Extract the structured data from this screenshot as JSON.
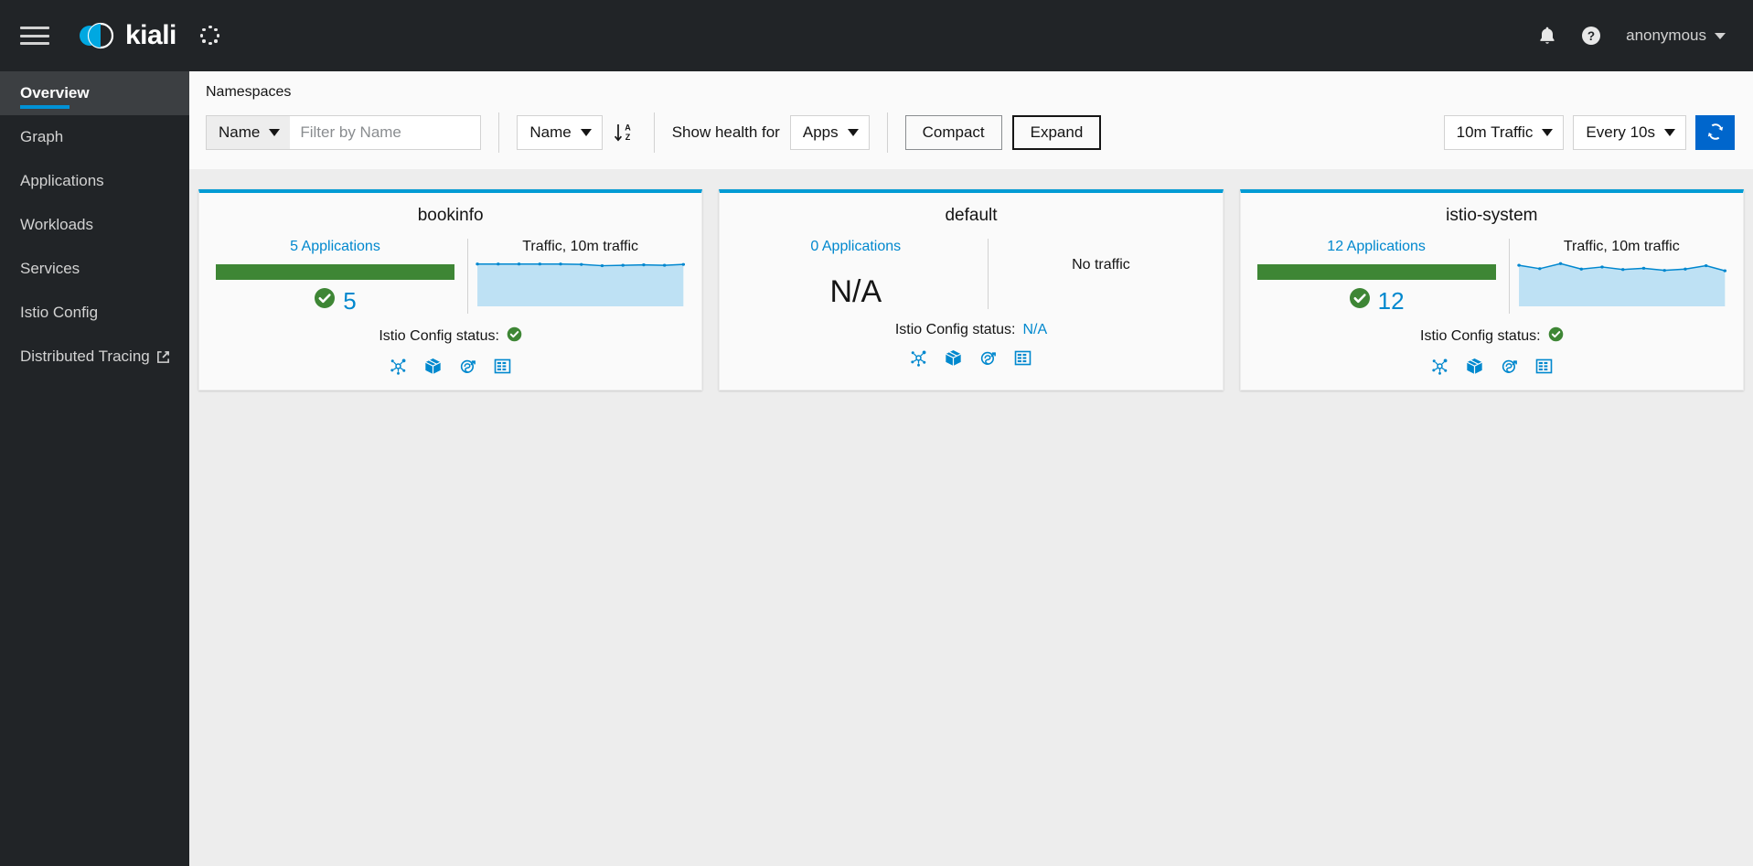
{
  "masthead": {
    "menu_icon": "hamburger-icon",
    "brand_name": "kiali",
    "loading_icon": "loading-spinner-icon",
    "notifications_icon": "bell-icon",
    "help_icon": "help-circle-icon",
    "user_name": "anonymous",
    "user_caret_icon": "chevron-down-icon"
  },
  "sidebar": {
    "items": [
      {
        "label": "Overview",
        "active": true,
        "external": false
      },
      {
        "label": "Graph",
        "active": false,
        "external": false
      },
      {
        "label": "Applications",
        "active": false,
        "external": false
      },
      {
        "label": "Workloads",
        "active": false,
        "external": false
      },
      {
        "label": "Services",
        "active": false,
        "external": false
      },
      {
        "label": "Istio Config",
        "active": false,
        "external": false
      },
      {
        "label": "Distributed Tracing",
        "active": false,
        "external": true
      }
    ]
  },
  "toolbar": {
    "title": "Namespaces",
    "filter_category": "Name",
    "filter_placeholder": "Filter by Name",
    "filter_value": "",
    "sort_field": "Name",
    "sort_direction_icon": "sort-ascending-az-icon",
    "show_health_label": "Show health for",
    "health_scope": "Apps",
    "compact_label": "Compact",
    "expand_label": "Expand",
    "active_view": "Expand",
    "traffic_range": "10m Traffic",
    "refresh_interval": "Every 10s",
    "refresh_icon": "refresh-icon",
    "refresh_button_color": "#0066cc"
  },
  "colors": {
    "card_accent": "#009bd4",
    "health_green": "#3e8635",
    "link_blue": "#0088ce",
    "chart_line": "#0087cf",
    "chart_fill": "#bee1f4",
    "sidebar_bg": "#212427"
  },
  "cards": [
    {
      "name": "bookinfo",
      "apps_link": "5 Applications",
      "has_health_bar": true,
      "health_count": "5",
      "health_status_icon": "check-circle-icon",
      "health_value_na": "",
      "traffic_title": "Traffic, 10m traffic",
      "has_traffic": true,
      "no_traffic_label": "",
      "istio_status_label": "Istio Config status:",
      "istio_status_value": "",
      "istio_status_icon": "check-circle-icon",
      "actions": [
        "graph-icon",
        "workloads-cube-icon",
        "services-icon",
        "istio-config-grid-icon"
      ]
    },
    {
      "name": "default",
      "apps_link": "0 Applications",
      "has_health_bar": false,
      "health_count": "",
      "health_status_icon": "",
      "health_value_na": "N/A",
      "traffic_title": "",
      "has_traffic": false,
      "no_traffic_label": "No traffic",
      "istio_status_label": "Istio Config status:",
      "istio_status_value": "N/A",
      "istio_status_icon": "",
      "actions": [
        "graph-icon",
        "workloads-cube-icon",
        "services-icon",
        "istio-config-grid-icon"
      ]
    },
    {
      "name": "istio-system",
      "apps_link": "12 Applications",
      "has_health_bar": true,
      "health_count": "12",
      "health_status_icon": "check-circle-icon",
      "health_value_na": "",
      "traffic_title": "Traffic, 10m traffic",
      "has_traffic": true,
      "no_traffic_label": "",
      "istio_status_label": "Istio Config status:",
      "istio_status_value": "",
      "istio_status_icon": "check-circle-icon",
      "actions": [
        "graph-icon",
        "workloads-cube-icon",
        "services-icon",
        "istio-config-grid-icon"
      ]
    }
  ],
  "chart_data": [
    {
      "type": "area",
      "title": "Traffic, 10m traffic",
      "namespace": "bookinfo",
      "x": [
        0,
        1,
        2,
        3,
        4,
        5,
        6,
        7,
        8,
        9,
        10
      ],
      "values": [
        100,
        100,
        100,
        100,
        100,
        99,
        96,
        97,
        98,
        97,
        99
      ],
      "ylim": [
        0,
        105
      ],
      "xlabel": "",
      "ylabel": "",
      "grid": false,
      "legend": "none"
    },
    {
      "type": "area",
      "title": "No traffic",
      "namespace": "default",
      "x": [],
      "values": [],
      "ylim": [
        0,
        0
      ],
      "xlabel": "",
      "ylabel": "",
      "grid": false,
      "legend": "none"
    },
    {
      "type": "area",
      "title": "Traffic, 10m traffic",
      "namespace": "istio-system",
      "x": [
        0,
        1,
        2,
        3,
        4,
        5,
        6,
        7,
        8,
        9,
        10
      ],
      "values": [
        96,
        88,
        100,
        87,
        91,
        86,
        89,
        84,
        87,
        95,
        83
      ],
      "ylim": [
        0,
        105
      ],
      "xlabel": "",
      "ylabel": "",
      "grid": false,
      "legend": "none"
    }
  ]
}
